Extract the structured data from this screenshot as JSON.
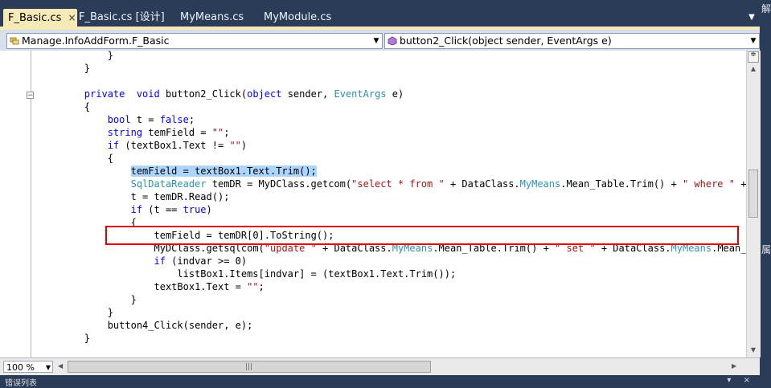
{
  "tabs": [
    {
      "label": "F_Basic.cs",
      "close": "×"
    },
    {
      "label": "F_Basic.cs [设计]"
    },
    {
      "label": "MyMeans.cs"
    },
    {
      "label": "MyModule.cs"
    }
  ],
  "side_labels": [
    "解",
    "属"
  ],
  "nav": {
    "class_combo": "Manage.InfoAddForm.F_Basic",
    "member_combo": "button2_Click(object sender, EventArgs e)"
  },
  "code_lines": [
    {
      "indent": "            ",
      "text": "}"
    },
    {
      "indent": "        ",
      "text": "}"
    },
    {
      "indent": "",
      "text": ""
    },
    {
      "indent": "        ",
      "tokens": [
        [
          "kw",
          "private"
        ],
        [
          "",
          "  "
        ],
        [
          "kw",
          "void"
        ],
        [
          "",
          " button2_Click("
        ],
        [
          "kw",
          "object"
        ],
        [
          "",
          " sender, "
        ],
        [
          "ty",
          "EventArgs"
        ],
        [
          "",
          " e)"
        ]
      ]
    },
    {
      "indent": "        ",
      "text": "{"
    },
    {
      "indent": "            ",
      "tokens": [
        [
          "kw",
          "bool"
        ],
        [
          "",
          " t = "
        ],
        [
          "kw",
          "false"
        ],
        [
          "",
          ";"
        ]
      ]
    },
    {
      "indent": "            ",
      "tokens": [
        [
          "kw",
          "string"
        ],
        [
          "",
          " temField = "
        ],
        [
          "st",
          "\"\""
        ],
        [
          "",
          ";"
        ]
      ]
    },
    {
      "indent": "            ",
      "tokens": [
        [
          "kw",
          "if"
        ],
        [
          "",
          " (textBox1.Text != "
        ],
        [
          "st",
          "\"\""
        ],
        [
          "",
          ")"
        ]
      ]
    },
    {
      "indent": "            ",
      "text": "{"
    },
    {
      "indent": "                ",
      "tokens": [
        [
          "sel",
          "temField = textBox1.Text.Trim();"
        ]
      ]
    },
    {
      "indent": "                ",
      "tokens": [
        [
          "ty",
          "SqlDataReader"
        ],
        [
          "",
          " temDR = MyDClass.getcom("
        ],
        [
          "st",
          "\"select * from \""
        ],
        [
          "",
          " + DataClass."
        ],
        [
          "ty",
          "MyMeans"
        ],
        [
          "",
          ".Mean_Table.Trim() + "
        ],
        [
          "st",
          "\" where \""
        ],
        [
          "",
          " + Dat"
        ]
      ]
    },
    {
      "indent": "                ",
      "text": "t = temDR.Read();"
    },
    {
      "indent": "                ",
      "tokens": [
        [
          "kw",
          "if"
        ],
        [
          "",
          " (t == "
        ],
        [
          "kw",
          "true"
        ],
        [
          "",
          ")"
        ]
      ]
    },
    {
      "indent": "                ",
      "text": "{"
    },
    {
      "indent": "                    ",
      "text": "temField = temDR[0].ToString();"
    },
    {
      "indent": "                    ",
      "tokens": [
        [
          "",
          "MyDClass.getsqlcom("
        ],
        [
          "st",
          "\"update \""
        ],
        [
          "",
          " + DataClass."
        ],
        [
          "ty",
          "MyMeans"
        ],
        [
          "",
          ".Mean_Table.Trim() + "
        ],
        [
          "st",
          "\" set \""
        ],
        [
          "",
          " + DataClass."
        ],
        [
          "ty",
          "MyMeans"
        ],
        [
          "",
          ".Mean_Fiel"
        ]
      ]
    },
    {
      "indent": "                    ",
      "tokens": [
        [
          "kw",
          "if"
        ],
        [
          "",
          " (indvar >= 0)"
        ]
      ]
    },
    {
      "indent": "                        ",
      "text": "listBox1.Items[indvar] = (textBox1.Text.Trim());"
    },
    {
      "indent": "                    ",
      "tokens": [
        [
          "",
          "textBox1.Text = "
        ],
        [
          "st",
          "\"\""
        ],
        [
          "",
          ";"
        ]
      ]
    },
    {
      "indent": "                ",
      "text": "}"
    },
    {
      "indent": "            ",
      "text": "}"
    },
    {
      "indent": "            ",
      "text": "button4_Click(sender, e);"
    },
    {
      "indent": "        ",
      "text": "}"
    }
  ],
  "status": {
    "zoom": "100 %"
  },
  "bottom_panel": {
    "label": "错误列表"
  }
}
